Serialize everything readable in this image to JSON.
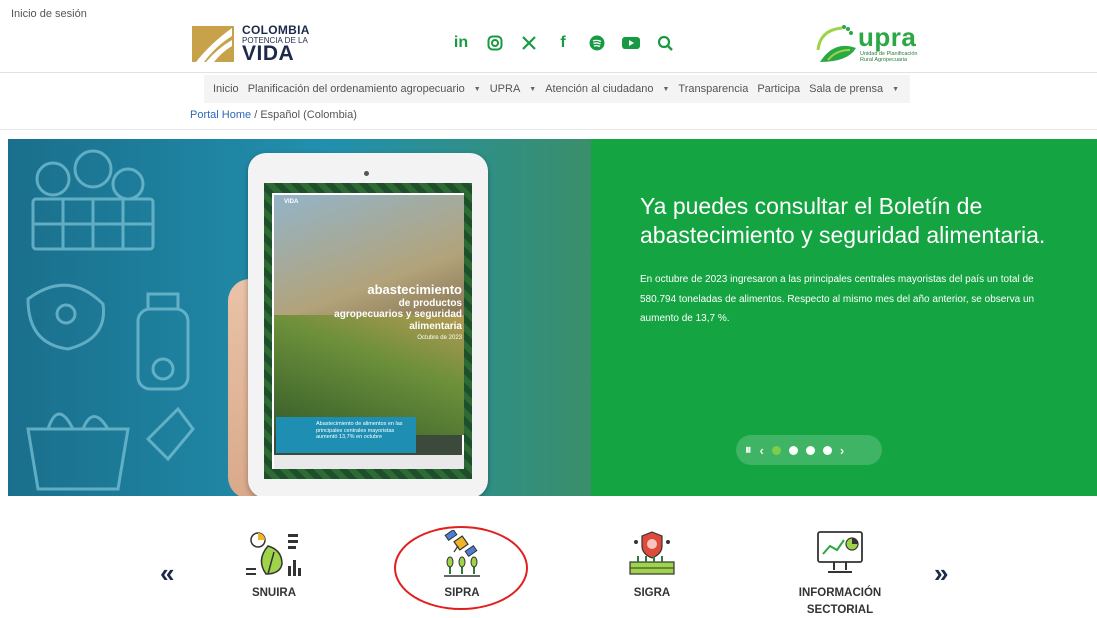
{
  "header": {
    "login_label": "Inicio de sesión",
    "gov_logo": {
      "line1": "COLOMBIA",
      "line2": "POTENCIA DE LA",
      "line3": "VIDA"
    },
    "social_icons": [
      "linkedin-icon",
      "instagram-icon",
      "x-icon",
      "facebook-icon",
      "spotify-icon",
      "youtube-icon",
      "search-icon"
    ],
    "upra_logo": {
      "name": "upra",
      "subtitle": "Unidad de Planificación Rural Agropecuaria"
    }
  },
  "nav": {
    "items": [
      {
        "label": "Inicio",
        "has_dropdown": false
      },
      {
        "label": "Planificación del ordenamiento agropecuario",
        "has_dropdown": true
      },
      {
        "label": "UPRA",
        "has_dropdown": true
      },
      {
        "label": "Atención al ciudadano",
        "has_dropdown": true
      },
      {
        "label": "Transparencia",
        "has_dropdown": false
      },
      {
        "label": "Participa",
        "has_dropdown": false
      },
      {
        "label": "Sala de prensa",
        "has_dropdown": true
      }
    ]
  },
  "breadcrumb": {
    "link": "Portal Home",
    "separator": " / ",
    "current": "Español (Colombia)"
  },
  "banner": {
    "title": "Ya puedes consultar el Boletín de abastecimiento y seguridad alimentaria.",
    "body": "En octubre de 2023 ingresaron a las principales centrales mayoristas del país un total de 580.794 toneladas de alimentos. Respecto al mismo mes del año anterior, se observa un aumento de 13,7 %.",
    "tablet": {
      "logo": "VIDA",
      "title_big": "abastecimiento",
      "title_rest": "de productos agropecuarios y seguridad alimentaria",
      "date": "Octubre de 2023",
      "box_text": "Abastecimiento de alimentos en las principales centrales mayoristas aumentó 13,7% en octubre"
    },
    "slides": {
      "count": 4,
      "active_index": 0
    }
  },
  "quick_links": {
    "items": [
      {
        "label": "SNUIRA",
        "icon": "leaf-chart-icon"
      },
      {
        "label": "SIPRA",
        "icon": "satellite-crops-icon",
        "highlighted": true
      },
      {
        "label": "SIGRA",
        "icon": "shield-crop-icon"
      },
      {
        "label": "INFORMACIÓN SECTORIAL",
        "icon": "monitor-chart-icon"
      }
    ],
    "prev_icon": "double-chevron-left-icon",
    "next_icon": "double-chevron-right-icon"
  },
  "colors": {
    "brand_green": "#14a442",
    "nav_bg": "#f4f4f4",
    "link_blue": "#2d68b8",
    "highlight_red": "#e02020",
    "navy": "#1d2a4a"
  }
}
